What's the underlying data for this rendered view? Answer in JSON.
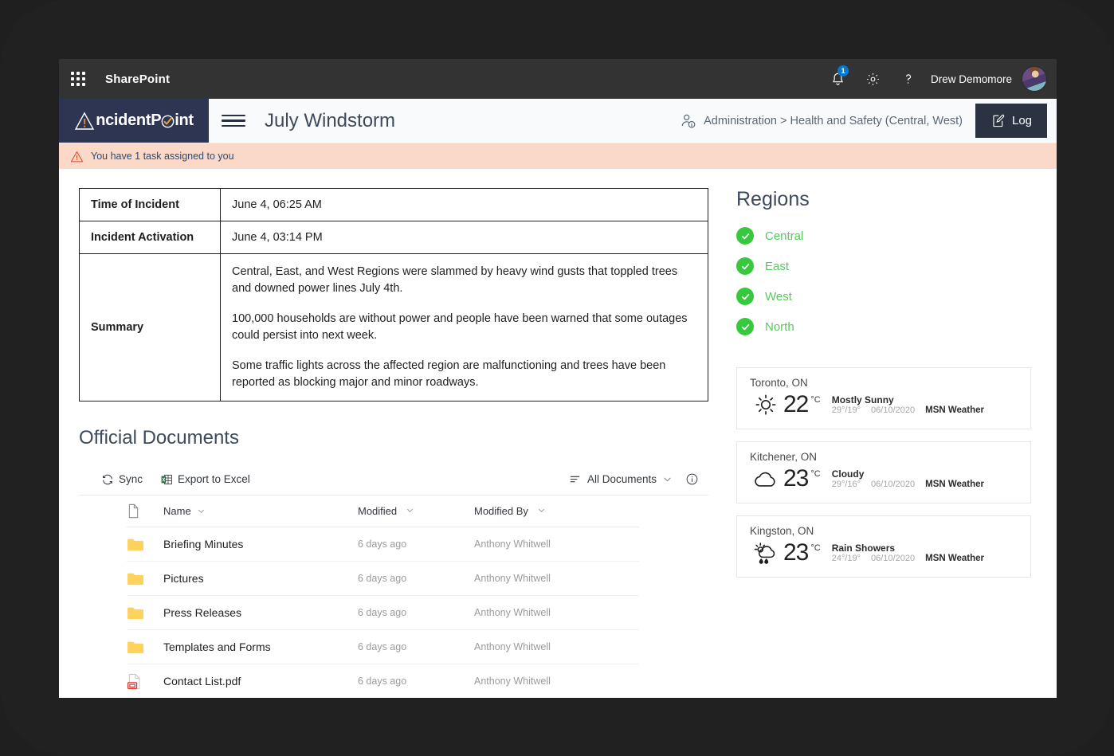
{
  "suite": {
    "waffle_icon": "app-launcher-icon",
    "brand": "SharePoint",
    "notifications": {
      "icon": "bell-icon",
      "badge": "1"
    },
    "settings_icon": "gear-icon",
    "help_icon": "question-mark-icon",
    "user_name": "Drew Demomore",
    "avatar": "user-avatar"
  },
  "site": {
    "logo_text": "IncidentPoint",
    "logo_prefix": "ncident",
    "logo_mid": "P",
    "logo_suffix": "int",
    "menu_icon": "hamburger-menu-icon",
    "page_title": "July Windstorm",
    "breadcrumb_icon": "person-info-icon",
    "breadcrumb": "Administration > Health and Safety (Central, West)",
    "log_button": "Log",
    "log_icon": "edit-note-icon"
  },
  "alert": {
    "icon": "warning-triangle-icon",
    "text": "You have 1 task assigned to you"
  },
  "incident": {
    "rows": [
      {
        "label": "Time of Incident",
        "value": "June 4, 06:25 AM"
      },
      {
        "label": "Incident Activation",
        "value": "June 4, 03:14 PM"
      }
    ],
    "summary_label": "Summary",
    "summary_paragraphs": [
      "Central, East, and West Regions were slammed by heavy wind gusts that toppled trees and downed power lines July 4th.",
      "100,000 households are without power and people have been warned that some outages could persist into next week.",
      "Some traffic lights across the affected region are malfunctioning and trees have been reported as blocking major and minor roadways."
    ]
  },
  "documents": {
    "title": "Official Documents",
    "toolbar": {
      "sync_label": "Sync",
      "sync_icon": "sync-icon",
      "export_label": "Export to Excel",
      "export_icon": "excel-grid-icon",
      "view_label": "All Documents",
      "view_icon": "list-view-icon",
      "view_chevron": "chevron-down-icon",
      "info_icon": "info-circle-icon"
    },
    "columns": {
      "icon": "file-type-icon",
      "name": "Name",
      "modified": "Modified",
      "modified_by": "Modified By"
    },
    "rows": [
      {
        "icon": "folder-icon",
        "name": "Briefing Minutes",
        "modified": "6 days ago",
        "modified_by": "Anthony Whitwell"
      },
      {
        "icon": "folder-icon",
        "name": "Pictures",
        "modified": "6 days ago",
        "modified_by": "Anthony Whitwell"
      },
      {
        "icon": "folder-icon",
        "name": "Press Releases",
        "modified": "6 days ago",
        "modified_by": "Anthony Whitwell"
      },
      {
        "icon": "folder-icon",
        "name": "Templates and Forms",
        "modified": "6 days ago",
        "modified_by": "Anthony Whitwell"
      },
      {
        "icon": "pdf-icon",
        "name": "Contact List.pdf",
        "modified": "6 days ago",
        "modified_by": "Anthony Whitwell"
      }
    ]
  },
  "regions": {
    "title": "Regions",
    "items": [
      {
        "name": "Central",
        "status": "checked"
      },
      {
        "name": "East",
        "status": "checked"
      },
      {
        "name": "West",
        "status": "checked"
      },
      {
        "name": "North",
        "status": "checked"
      }
    ]
  },
  "weather": [
    {
      "city": "Toronto, ON",
      "icon": "sun-icon",
      "temp": "22",
      "unit": "°C",
      "condition": "Mostly Sunny",
      "hi_lo": "29°/19°",
      "date": "06/10/2020",
      "source": "MSN Weather"
    },
    {
      "city": "Kitchener, ON",
      "icon": "cloud-icon",
      "temp": "23",
      "unit": "°C",
      "condition": "Cloudy",
      "hi_lo": "29°/16°",
      "date": "06/10/2020",
      "source": "MSN Weather"
    },
    {
      "city": "Kingston, ON",
      "icon": "rain-shower-icon",
      "temp": "23",
      "unit": "°C",
      "condition": "Rain Showers",
      "hi_lo": "24°/19°",
      "date": "06/10/2020",
      "source": "MSN Weather"
    }
  ],
  "colors": {
    "suite_bar": "#333333",
    "logo_bg": "#2e3553",
    "alert_bg": "#fbd9c8",
    "alert_text": "#2c4a73",
    "accent_orange": "#e8751a",
    "region_green": "#36c93e",
    "log_button": "#2b3342",
    "badge_blue": "#0078d4",
    "folder_yellow": "#ffd25e"
  }
}
